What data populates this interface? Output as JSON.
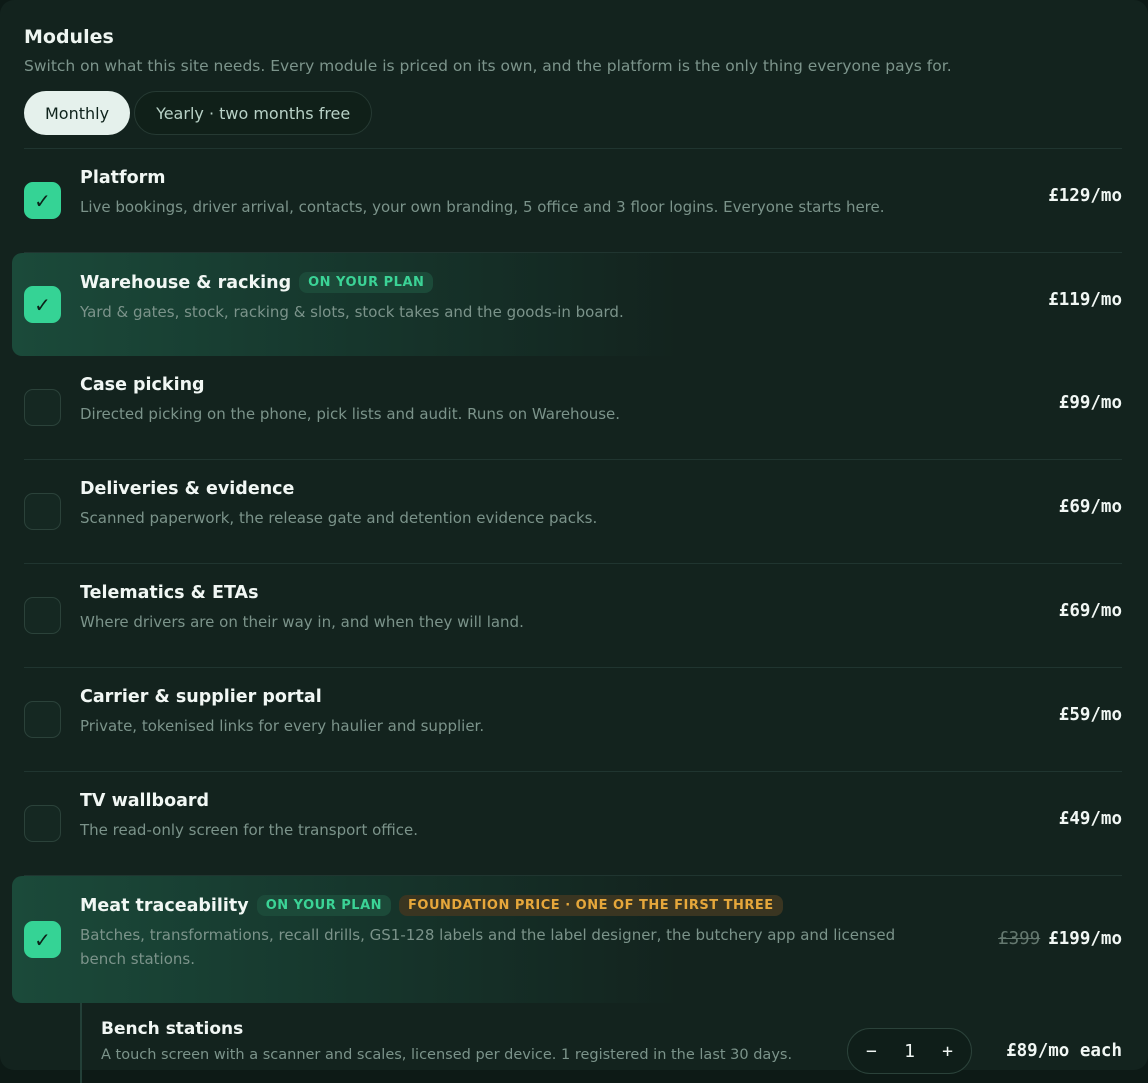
{
  "header": {
    "title": "Modules",
    "subtitle": "Switch on what this site needs. Every module is priced on its own, and the platform is the only thing everyone pays for."
  },
  "billing": {
    "monthly": "Monthly",
    "yearly": "Yearly · two months free",
    "selected": "Monthly"
  },
  "modules": [
    {
      "name": "Platform",
      "desc": "Live bookings, driver arrival, contacts, your own branding, 5 office and 3 floor logins. Everyone starts here.",
      "price": "£129/mo",
      "checked": true
    },
    {
      "name": "Warehouse & racking",
      "badge": "ON YOUR PLAN",
      "desc": "Yard & gates, stock, racking & slots, stock takes and the goods-in board.",
      "price": "£119/mo",
      "checked": true
    },
    {
      "name": "Case picking",
      "desc": "Directed picking on the phone, pick lists and audit. Runs on Warehouse.",
      "price": "£99/mo",
      "checked": false
    },
    {
      "name": "Deliveries & evidence",
      "desc": "Scanned paperwork, the release gate and detention evidence packs.",
      "price": "£69/mo",
      "checked": false
    },
    {
      "name": "Telematics & ETAs",
      "desc": "Where drivers are on their way in, and when they will land.",
      "price": "£69/mo",
      "checked": false
    },
    {
      "name": "Carrier & supplier portal",
      "desc": "Private, tokenised links for every haulier and supplier.",
      "price": "£59/mo",
      "checked": false
    },
    {
      "name": "TV wallboard",
      "desc": "The read-only screen for the transport office.",
      "price": "£49/mo",
      "checked": false
    },
    {
      "name": "Meat traceability",
      "badge": "ON YOUR PLAN",
      "badge2": "FOUNDATION PRICE · ONE OF THE FIRST THREE",
      "desc": "Batches, transformations, recall drills, GS1-128 labels and the label designer, the butchery app and licensed bench stations.",
      "old_price": "£399",
      "price": "£199/mo",
      "checked": true
    }
  ],
  "bench": {
    "name": "Bench stations",
    "desc": "A touch screen with a scanner and scales, licensed per device. 1 registered in the last 30 days.",
    "minus": "−",
    "qty": "1",
    "plus": "+",
    "price": "£89/mo each"
  },
  "icons": {
    "check": "check-icon"
  },
  "colors": {
    "accent": "#35d395",
    "warning": "#e6a73b"
  }
}
